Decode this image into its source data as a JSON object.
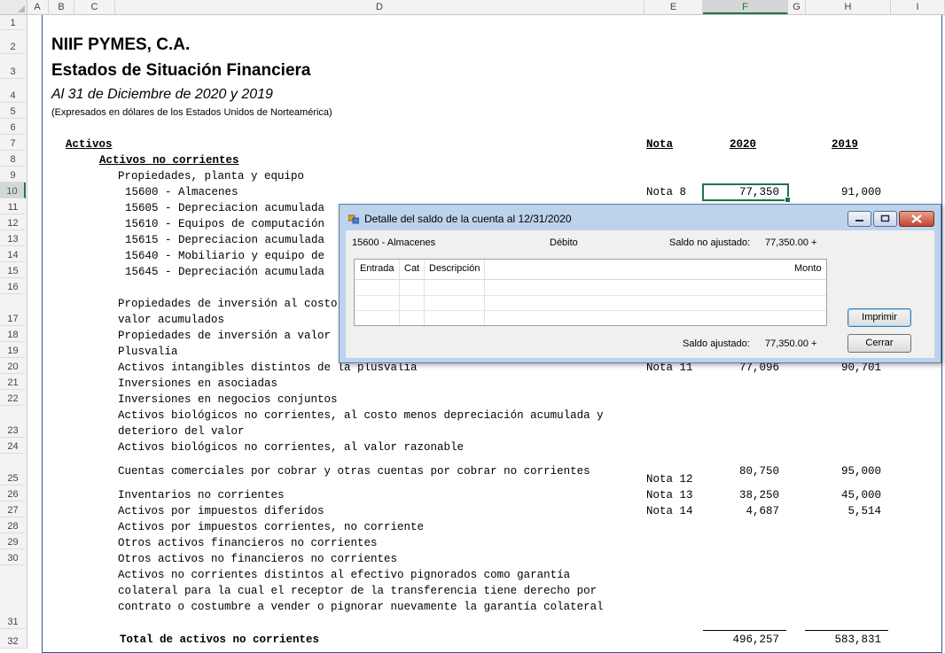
{
  "columns": [
    "A",
    "B",
    "C",
    "D",
    "E",
    "F",
    "G",
    "H",
    "I"
  ],
  "rows": [
    "1",
    "2",
    "3",
    "4",
    "5",
    "6",
    "7",
    "8",
    "9",
    "10",
    "11",
    "12",
    "13",
    "14",
    "15",
    "16",
    "17",
    "18",
    "19",
    "20",
    "21",
    "22",
    "23",
    "24",
    "25",
    "26",
    "27",
    "28",
    "29",
    "30",
    "31",
    "32"
  ],
  "header": {
    "company": "NIIF PYMES, C.A.",
    "title": "Estados de Situación Financiera",
    "period": "Al 31 de Diciembre de 2020 y 2019",
    "currency_note": "(Expresados en dólares de los Estados Unidos de Norteamérica)"
  },
  "labels": {
    "activos": "Activos ",
    "nota": "Nota",
    "y2020": "2020",
    "y2019": "2019",
    "activos_no_corrientes": "Activos no corrientes ",
    "ppe": "Propiedades, planta y equipo"
  },
  "accounts": [
    "15600 - Almacenes",
    "15605 - Depreciacion acumulada",
    "15610 - Equipos de computación",
    "15615 - Depreciacion acumulada",
    "15640 - Mobiliario y equipo de",
    "15645 - Depreciación acumulada"
  ],
  "almacenes": {
    "nota": "Nota 8",
    "v2020": "77,350",
    "v2019": "91,000"
  },
  "lines": {
    "r16": "Propiedades de inversión al costo",
    "r17": "valor acumulados",
    "r18": "Propiedades de inversión a valor",
    "r19": "Plusvalía",
    "r20": "Activos intangibles distintos de la plusvalía",
    "r21": "Inversiones en asociadas",
    "r22": "Inversiones en negocios conjuntos",
    "r23a": "Activos biológicos no corrientes, al costo menos depreciación acumulada y",
    "r23b": "deterioro del valor",
    "r24": "Activos biológicos no corrientes, al valor razonable",
    "r25": "Cuentas comerciales por cobrar y otras cuentas por cobrar no corrientes",
    "r26": "Inventarios no corrientes",
    "r27": "Activos por impuestos diferidos",
    "r28": "Activos por impuestos corrientes, no corriente",
    "r29": "Otros activos financieros no corrientes",
    "r30": "Otros activos no financieros no corrientes",
    "r31a": "Activos no corrientes distintos al efectivo pignorados como garantía",
    "r31b": "colateral para la cual el receptor de la transferencia tiene derecho por",
    "r31c": "contrato o costumbre a vender o pignorar nuevamente la garantía colateral",
    "r32": "Total de activos no corrientes"
  },
  "values": {
    "r20": {
      "nota": "Nota 11",
      "v2020": "77,096",
      "v2019": "90,701"
    },
    "r25": {
      "nota": "Nota 12",
      "v2020": "80,750",
      "v2019": "95,000"
    },
    "r26": {
      "nota": "Nota 13",
      "v2020": "38,250",
      "v2019": "45,000"
    },
    "r27": {
      "nota": "Nota 14",
      "v2020": "4,687",
      "v2019": "5,514"
    },
    "r32": {
      "v2020": "496,257",
      "v2019": "583,831"
    }
  },
  "dialog": {
    "title": "Detalle del saldo de la cuenta al 12/31/2020",
    "account": "15600 - Almacenes",
    "type": "Débito",
    "unadjusted_label": "Saldo no ajustado:",
    "unadjusted_value": "77,350.00 +",
    "adjusted_label": "Saldo ajustado:",
    "adjusted_value": "77,350.00 +",
    "grid_headers": [
      "Entrada",
      "Cat",
      "Descripción",
      "Monto"
    ],
    "print_button": "Imprimir",
    "close_button": "Cerrar"
  },
  "colors": {
    "excel_green": "#217346",
    "frame_blue": "#2f5597",
    "dialog_frame": "#bcd3ec"
  }
}
